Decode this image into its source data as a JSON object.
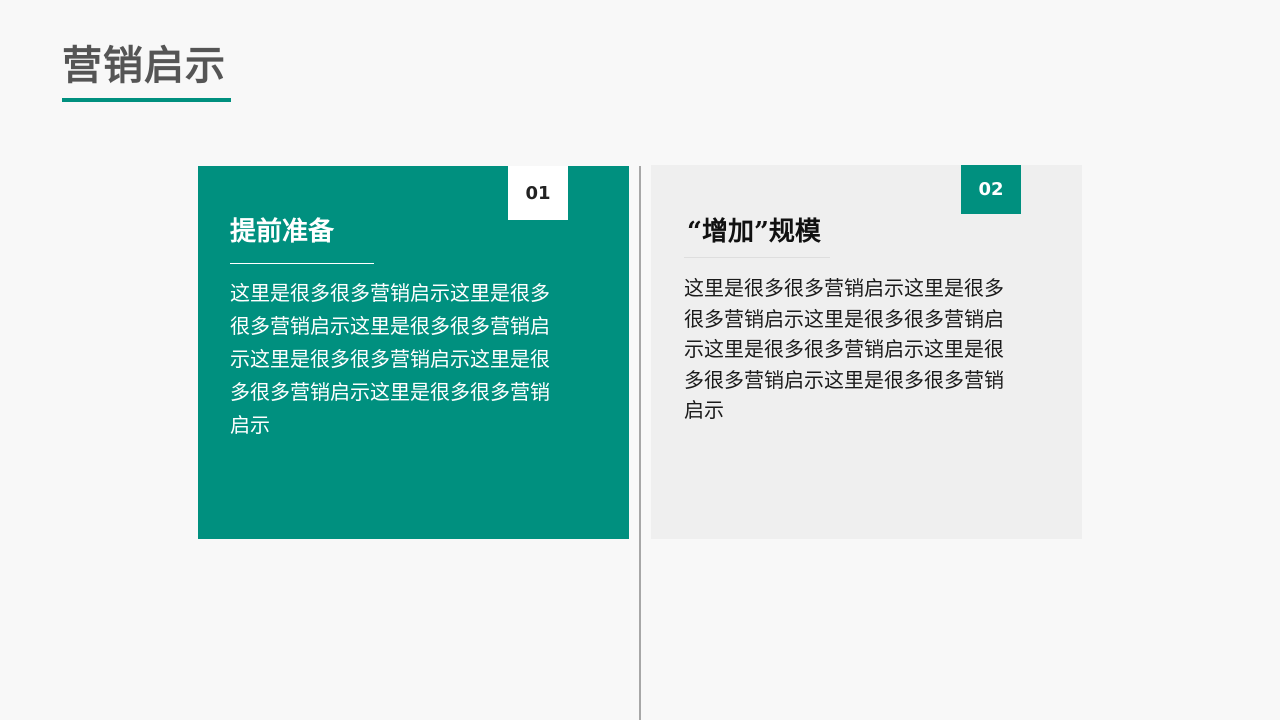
{
  "page": {
    "title": "营销启示"
  },
  "colors": {
    "accent": "#00907f",
    "background": "#f8f8f8",
    "card_gray": "#efefef",
    "title_text": "#555555"
  },
  "cards": [
    {
      "number": "01",
      "heading": "提前准备",
      "body": "这里是很多很多营销启示这里是很多很多营销启示这里是很多很多营销启示这里是很多很多营销启示这里是很多很多营销启示这里是很多很多营销启示"
    },
    {
      "number": "02",
      "heading": "“增加”规模",
      "body": "这里是很多很多营销启示这里是很多很多营销启示这里是很多很多营销启示这里是很多很多营销启示这里是很多很多营销启示这里是很多很多营销启示"
    }
  ]
}
